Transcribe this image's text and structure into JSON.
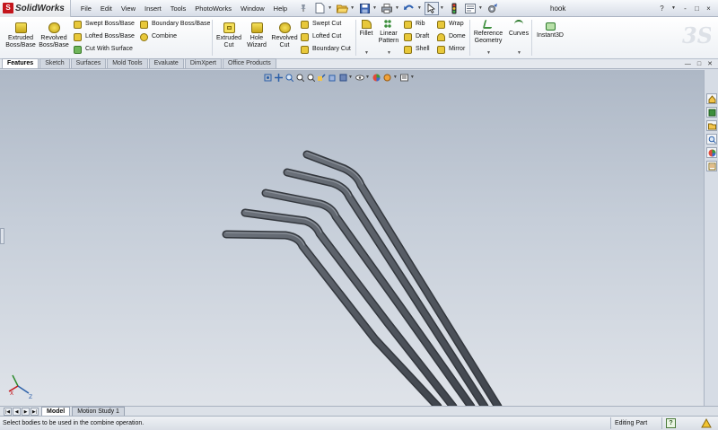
{
  "app": {
    "title": "SolidWorks",
    "document": "hook"
  },
  "menu": [
    "File",
    "Edit",
    "View",
    "Insert",
    "Tools",
    "PhotoWorks",
    "Window",
    "Help"
  ],
  "window_controls": {
    "help": "?",
    "min": "-",
    "restore": "□",
    "close": "×"
  },
  "ribbon": {
    "extruded_boss": "Extruded Boss/Base",
    "revolved_boss": "Revolved Boss/Base",
    "swept_boss": "Swept Boss/Base",
    "lofted_boss": "Lofted Boss/Base",
    "cut_with_surface": "Cut With Surface",
    "boundary_boss": "Boundary Boss/Base",
    "combine": "Combine",
    "extruded_cut": "Extruded Cut",
    "hole_wizard": "Hole Wizard",
    "revolved_cut": "Revolved Cut",
    "swept_cut": "Swept Cut",
    "lofted_cut": "Lofted Cut",
    "boundary_cut": "Boundary Cut",
    "fillet": "Fillet",
    "linear_pattern": "Linear Pattern",
    "rib": "Rib",
    "draft": "Draft",
    "shell": "Shell",
    "wrap": "Wrap",
    "dome": "Dome",
    "mirror": "Mirror",
    "reference_geometry": "Reference Geometry",
    "curves": "Curves",
    "instant3d": "Instant3D"
  },
  "tabs": [
    "Features",
    "Sketch",
    "Surfaces",
    "Mold Tools",
    "Evaluate",
    "DimXpert",
    "Office Products"
  ],
  "active_tab": "Features",
  "bottom_tabs": [
    "Model",
    "Motion Study 1"
  ],
  "status": {
    "message": "Select bodies to be used in the combine operation.",
    "mode": "Editing Part",
    "help": "?"
  },
  "colors": {
    "accent": "#c4161c",
    "model": "#4b5058",
    "viewport_top": "#aeb8c6",
    "viewport_bottom": "#dfe3e9"
  }
}
